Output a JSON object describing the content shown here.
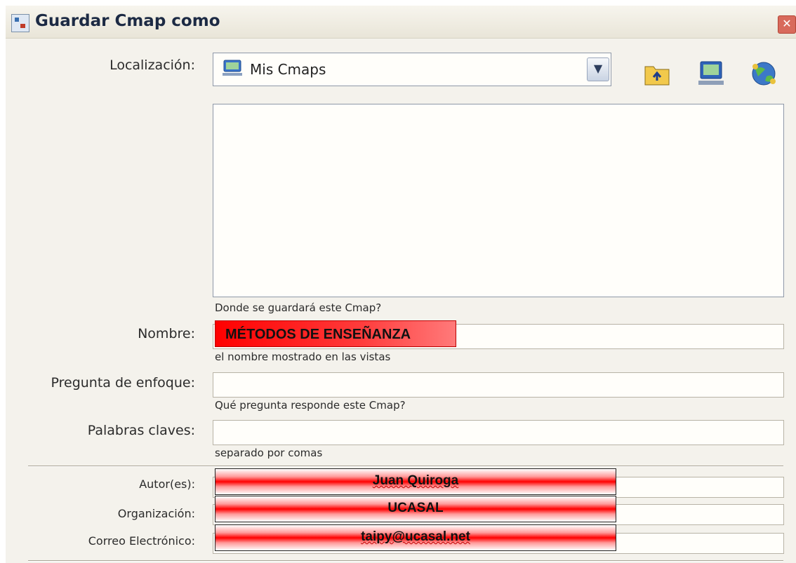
{
  "window": {
    "title": "Guardar Cmap como",
    "close_glyph": "✕"
  },
  "location": {
    "label": "Localización:",
    "selected": "Mis Cmaps",
    "icon": "computer-icon",
    "hint": "Donde se guardará este Cmap?",
    "toolbar": [
      "folder-up-icon",
      "my-computer-icon",
      "network-globe-icon"
    ]
  },
  "name": {
    "label": "Nombre:",
    "value": "MÉTODOS DE ENSEÑANZA",
    "hint": "el nombre mostrado en las vistas"
  },
  "focus_question": {
    "label": "Pregunta de enfoque:",
    "value": "",
    "hint": "Qué pregunta responde este Cmap?"
  },
  "keywords": {
    "label": "Palabras claves:",
    "value": "",
    "hint": "separado por comas"
  },
  "author": {
    "label": "Autor(es):",
    "value": "Juan Quiroga"
  },
  "organization": {
    "label": "Organización:",
    "value": "UCASAL"
  },
  "email": {
    "label": "Correo Electrónico:",
    "value": "taipy@ucasal.net"
  },
  "colors": {
    "red_highlight": "#ff0000",
    "panel_bg": "#f4f2ec"
  }
}
